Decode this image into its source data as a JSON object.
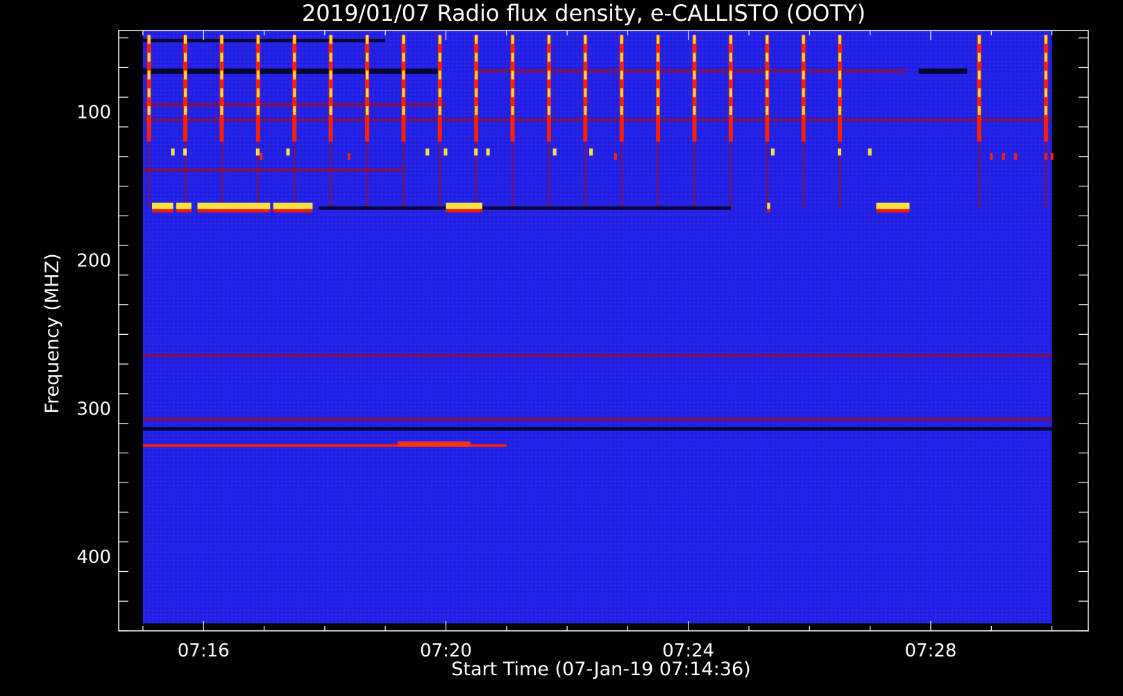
{
  "chart_data": {
    "type": "heatmap",
    "title": "2019/01/07  Radio flux density, e-CALLISTO (OOTY)",
    "xlabel": "Start Time (07-Jan-19 07:14:36)",
    "ylabel": "Frequency (MHZ)",
    "x_ticks": [
      "07:16",
      "07:20",
      "07:24",
      "07:28"
    ],
    "x_tick_minutes": [
      16,
      20,
      24,
      28
    ],
    "x_range_minutes": [
      14.6,
      30.6
    ],
    "data_x_range_minutes": [
      15.0,
      30.0
    ],
    "y_ticks": [
      100,
      200,
      300,
      400
    ],
    "y_range": [
      45,
      450
    ],
    "data_y_range": [
      45,
      445
    ],
    "y_reversed": true,
    "colormap_background": "#2020e8",
    "colors": {
      "background": "#000000",
      "axes": "#ffffff",
      "noise": "#1d1de6",
      "hot": "#ffe040",
      "warm": "#ff2000",
      "dim": "#8a1040",
      "dark_band": "#000020"
    },
    "periodic_spikes_minutes": [
      15.1,
      15.7,
      16.3,
      16.9,
      17.5,
      18.1,
      18.7,
      19.3,
      19.9,
      20.5,
      21.1,
      21.7,
      22.3,
      22.9,
      23.5,
      24.1,
      24.7,
      25.3,
      25.9,
      26.5,
      28.8,
      29.9
    ],
    "spike_freq_range": [
      48,
      120
    ],
    "dark_bands": [
      {
        "freq": 52,
        "t_start": 15.0,
        "t_end": 19.0
      },
      {
        "freq": 72,
        "t_start": 15.0,
        "t_end": 19.9
      },
      {
        "freq": 72,
        "t_start": 27.8,
        "t_end": 28.6
      },
      {
        "freq": 165,
        "t_start": 17.9,
        "t_end": 24.7
      },
      {
        "freq": 314,
        "t_start": 15.0,
        "t_end": 30.0
      }
    ],
    "dim_red_bands": [
      {
        "freq": 72,
        "t_start": 20.5,
        "t_end": 27.6
      },
      {
        "freq": 95,
        "t_start": 15.0,
        "t_end": 20.0
      },
      {
        "freq": 105,
        "t_start": 15.0,
        "t_end": 30.0
      },
      {
        "freq": 139,
        "t_start": 15.0,
        "t_end": 19.3
      },
      {
        "freq": 264,
        "t_start": 15.0,
        "t_end": 30.0
      },
      {
        "freq": 307,
        "t_start": 15.0,
        "t_end": 30.0
      }
    ],
    "bright_segments": [
      {
        "freq": 165,
        "t_start": 15.15,
        "t_end": 15.5
      },
      {
        "freq": 165,
        "t_start": 15.55,
        "t_end": 15.8
      },
      {
        "freq": 165,
        "t_start": 15.9,
        "t_end": 17.1
      },
      {
        "freq": 165,
        "t_start": 17.15,
        "t_end": 17.8
      },
      {
        "freq": 165,
        "t_start": 20.0,
        "t_end": 20.6
      },
      {
        "freq": 165,
        "t_start": 25.3,
        "t_end": 25.35
      },
      {
        "freq": 165,
        "t_start": 27.1,
        "t_end": 27.65
      }
    ],
    "short_bursts": [
      {
        "freq": 127,
        "t": 15.5
      },
      {
        "freq": 127,
        "t": 15.7
      },
      {
        "freq": 127,
        "t": 16.9
      },
      {
        "freq": 127,
        "t": 17.4
      },
      {
        "freq": 127,
        "t": 19.7
      },
      {
        "freq": 127,
        "t": 20.0
      },
      {
        "freq": 127,
        "t": 20.5
      },
      {
        "freq": 127,
        "t": 20.7
      },
      {
        "freq": 127,
        "t": 21.8
      },
      {
        "freq": 127,
        "t": 22.4
      },
      {
        "freq": 127,
        "t": 25.4
      },
      {
        "freq": 127,
        "t": 26.5
      },
      {
        "freq": 127,
        "t": 27.0
      }
    ],
    "red_bursts": [
      {
        "freq": 130,
        "t": 16.95
      },
      {
        "freq": 130,
        "t": 18.4
      },
      {
        "freq": 130,
        "t": 22.8
      },
      {
        "freq": 130,
        "t": 29.0
      },
      {
        "freq": 130,
        "t": 29.2
      },
      {
        "freq": 130,
        "t": 29.4
      },
      {
        "freq": 130,
        "t": 29.9
      },
      {
        "freq": 130,
        "t": 30.0
      }
    ],
    "interference_line": {
      "freq": 325,
      "t_start": 15.0,
      "t_end": 21.0,
      "peak_t_start": 19.2,
      "peak_t_end": 20.4
    }
  }
}
